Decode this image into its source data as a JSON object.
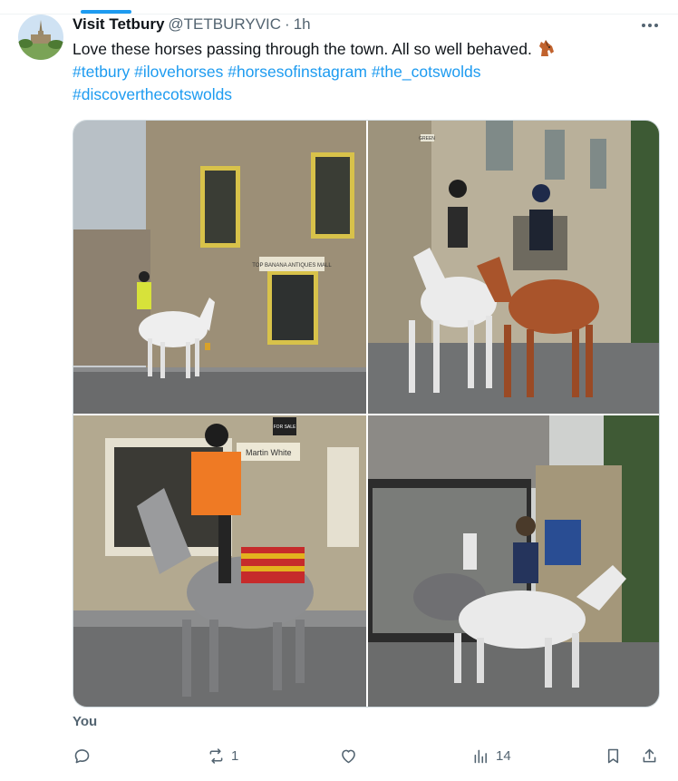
{
  "tweet": {
    "display_name": "Visit Tetbury",
    "handle": "@TETBURYVIC",
    "separator": "·",
    "time": "1h",
    "text": "Love these horses passing through the town. All so well behaved.",
    "emoji_icon": "horse-face-icon",
    "hashtags_line1": [
      "#tetbury",
      "#ilovehorses",
      "#horsesofinstagram",
      "#the_cotswolds"
    ],
    "hashtags_line2": [
      "#discoverthecotswolds"
    ]
  },
  "media": {
    "photos": [
      {
        "sign_text": "TOP BANANA ANTIQUES MALL"
      },
      {
        "sign_text": "GREEN"
      },
      {
        "sign_text": "Martin White",
        "board_text": "FOR SALE"
      },
      {
        "sign_text": ""
      }
    ]
  },
  "footer": {
    "you_label": "You"
  },
  "actions": {
    "reply": {
      "icon": "reply-icon",
      "count": ""
    },
    "repost": {
      "icon": "repost-icon",
      "count": "1"
    },
    "like": {
      "icon": "heart-icon",
      "count": ""
    },
    "views": {
      "icon": "views-chart-icon",
      "count": "14"
    },
    "bookmark": {
      "icon": "bookmark-icon"
    },
    "share": {
      "icon": "share-icon"
    }
  },
  "colors": {
    "link": "#1d9bf0",
    "text": "#0f1419",
    "muted": "#536471",
    "border": "#cfd9de"
  }
}
